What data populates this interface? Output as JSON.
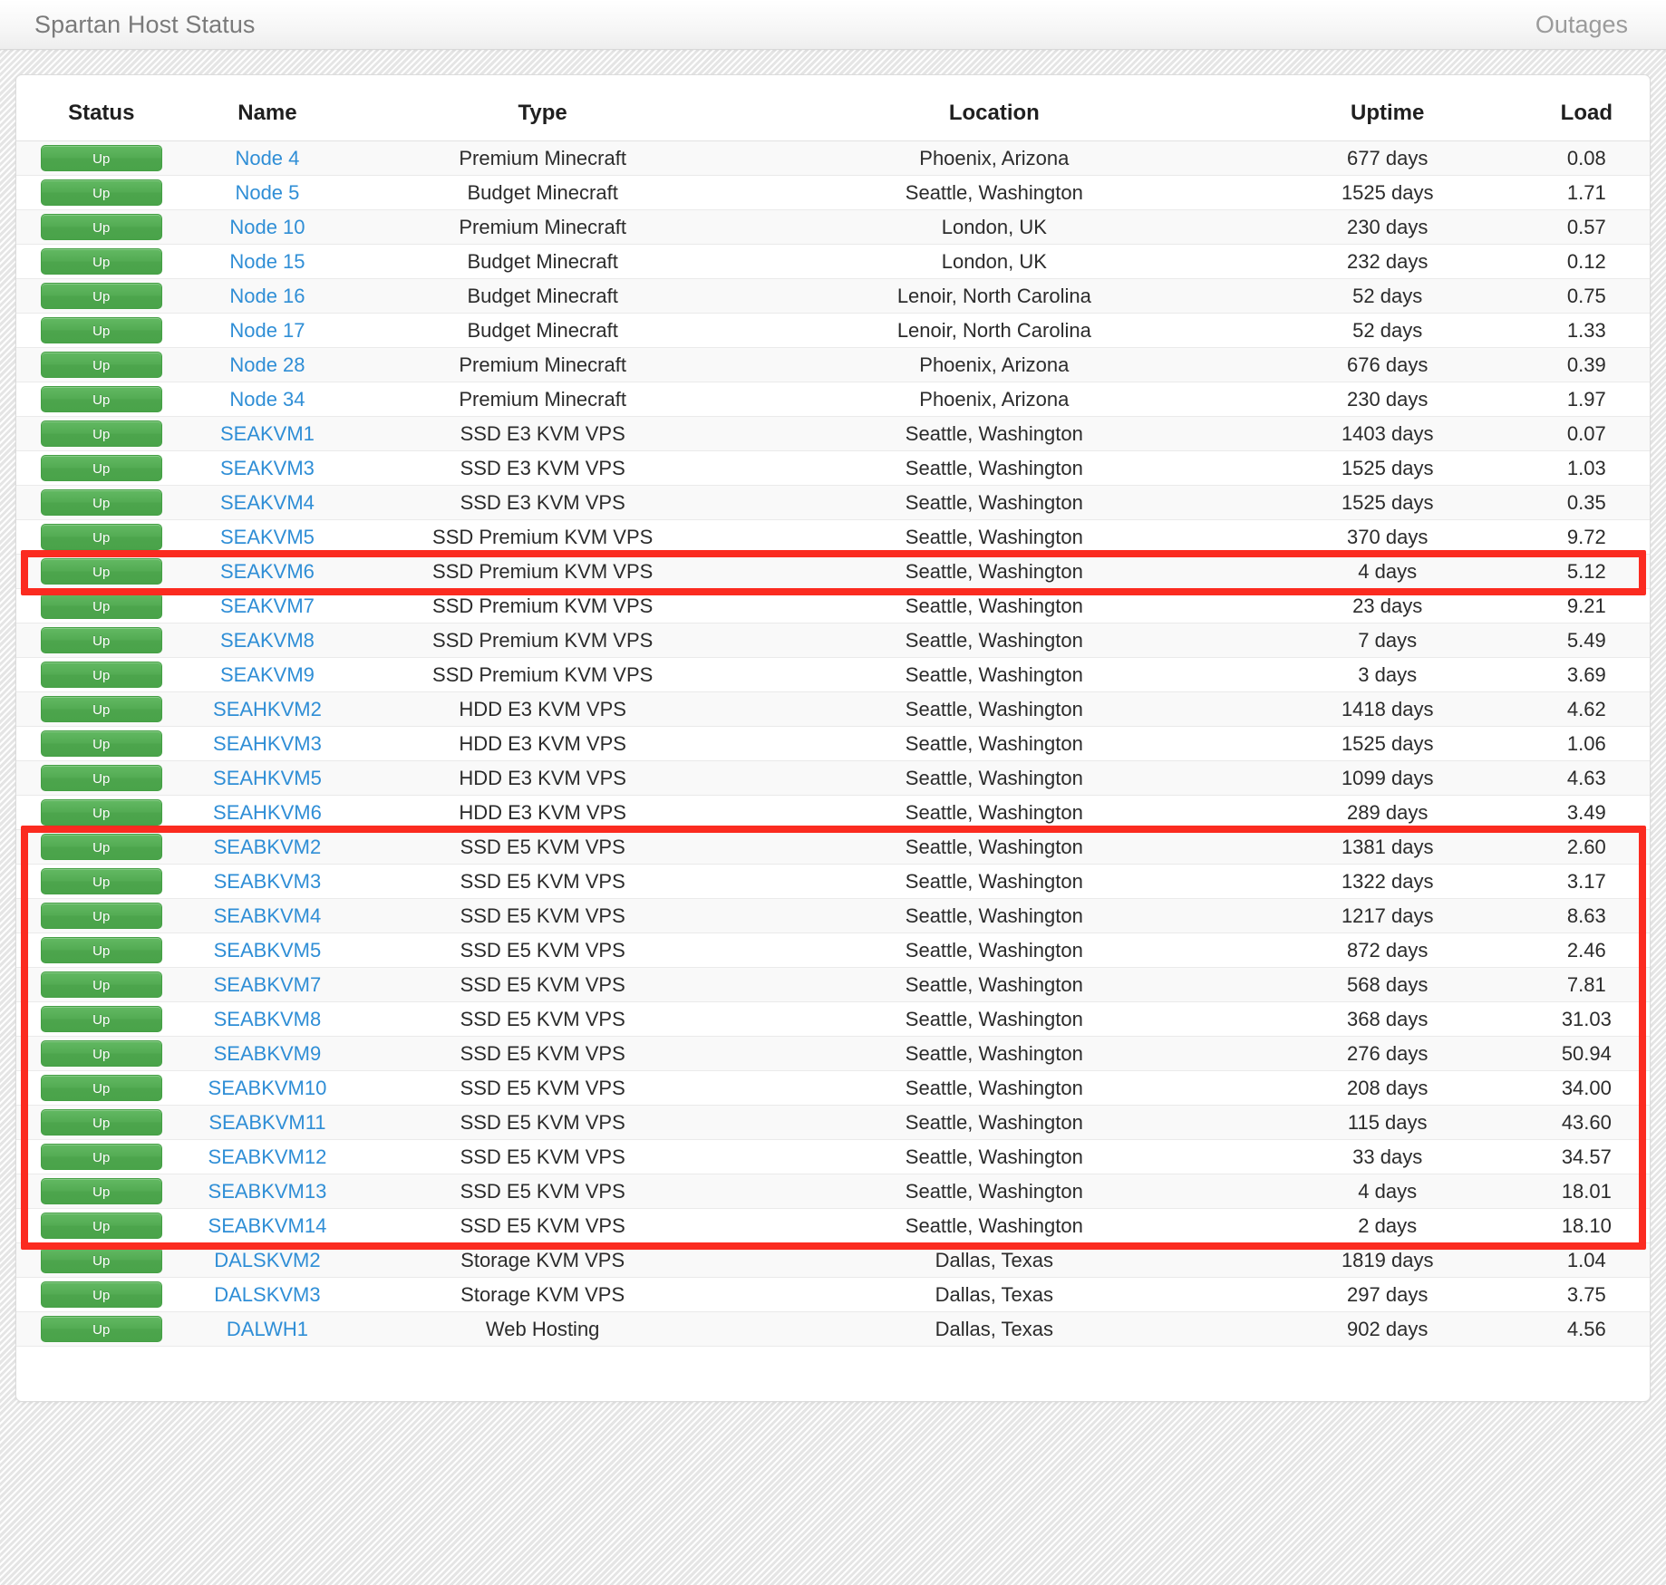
{
  "navbar": {
    "brand": "Spartan Host Status",
    "outages_link": "Outages"
  },
  "table": {
    "columns": [
      "Status",
      "Name",
      "Type",
      "Location",
      "Uptime",
      "Load"
    ],
    "rows": [
      {
        "status": "Up",
        "name": "Node 4",
        "type": "Premium Minecraft",
        "location": "Phoenix, Arizona",
        "uptime": "677 days",
        "load": "0.08"
      },
      {
        "status": "Up",
        "name": "Node 5",
        "type": "Budget Minecraft",
        "location": "Seattle, Washington",
        "uptime": "1525 days",
        "load": "1.71"
      },
      {
        "status": "Up",
        "name": "Node 10",
        "type": "Premium Minecraft",
        "location": "London, UK",
        "uptime": "230 days",
        "load": "0.57"
      },
      {
        "status": "Up",
        "name": "Node 15",
        "type": "Budget Minecraft",
        "location": "London, UK",
        "uptime": "232 days",
        "load": "0.12"
      },
      {
        "status": "Up",
        "name": "Node 16",
        "type": "Budget Minecraft",
        "location": "Lenoir, North Carolina",
        "uptime": "52 days",
        "load": "0.75"
      },
      {
        "status": "Up",
        "name": "Node 17",
        "type": "Budget Minecraft",
        "location": "Lenoir, North Carolina",
        "uptime": "52 days",
        "load": "1.33"
      },
      {
        "status": "Up",
        "name": "Node 28",
        "type": "Premium Minecraft",
        "location": "Phoenix, Arizona",
        "uptime": "676 days",
        "load": "0.39"
      },
      {
        "status": "Up",
        "name": "Node 34",
        "type": "Premium Minecraft",
        "location": "Phoenix, Arizona",
        "uptime": "230 days",
        "load": "1.97"
      },
      {
        "status": "Up",
        "name": "SEAKVM1",
        "type": "SSD E3 KVM VPS",
        "location": "Seattle, Washington",
        "uptime": "1403 days",
        "load": "0.07"
      },
      {
        "status": "Up",
        "name": "SEAKVM3",
        "type": "SSD E3 KVM VPS",
        "location": "Seattle, Washington",
        "uptime": "1525 days",
        "load": "1.03"
      },
      {
        "status": "Up",
        "name": "SEAKVM4",
        "type": "SSD E3 KVM VPS",
        "location": "Seattle, Washington",
        "uptime": "1525 days",
        "load": "0.35"
      },
      {
        "status": "Up",
        "name": "SEAKVM5",
        "type": "SSD Premium KVM VPS",
        "location": "Seattle, Washington",
        "uptime": "370 days",
        "load": "9.72"
      },
      {
        "status": "Up",
        "name": "SEAKVM6",
        "type": "SSD Premium KVM VPS",
        "location": "Seattle, Washington",
        "uptime": "4 days",
        "load": "5.12"
      },
      {
        "status": "Up",
        "name": "SEAKVM7",
        "type": "SSD Premium KVM VPS",
        "location": "Seattle, Washington",
        "uptime": "23 days",
        "load": "9.21"
      },
      {
        "status": "Up",
        "name": "SEAKVM8",
        "type": "SSD Premium KVM VPS",
        "location": "Seattle, Washington",
        "uptime": "7 days",
        "load": "5.49"
      },
      {
        "status": "Up",
        "name": "SEAKVM9",
        "type": "SSD Premium KVM VPS",
        "location": "Seattle, Washington",
        "uptime": "3 days",
        "load": "3.69"
      },
      {
        "status": "Up",
        "name": "SEAHKVM2",
        "type": "HDD E3 KVM VPS",
        "location": "Seattle, Washington",
        "uptime": "1418 days",
        "load": "4.62"
      },
      {
        "status": "Up",
        "name": "SEAHKVM3",
        "type": "HDD E3 KVM VPS",
        "location": "Seattle, Washington",
        "uptime": "1525 days",
        "load": "1.06"
      },
      {
        "status": "Up",
        "name": "SEAHKVM5",
        "type": "HDD E3 KVM VPS",
        "location": "Seattle, Washington",
        "uptime": "1099 days",
        "load": "4.63"
      },
      {
        "status": "Up",
        "name": "SEAHKVM6",
        "type": "HDD E3 KVM VPS",
        "location": "Seattle, Washington",
        "uptime": "289 days",
        "load": "3.49"
      },
      {
        "status": "Up",
        "name": "SEABKVM2",
        "type": "SSD E5 KVM VPS",
        "location": "Seattle, Washington",
        "uptime": "1381 days",
        "load": "2.60"
      },
      {
        "status": "Up",
        "name": "SEABKVM3",
        "type": "SSD E5 KVM VPS",
        "location": "Seattle, Washington",
        "uptime": "1322 days",
        "load": "3.17"
      },
      {
        "status": "Up",
        "name": "SEABKVM4",
        "type": "SSD E5 KVM VPS",
        "location": "Seattle, Washington",
        "uptime": "1217 days",
        "load": "8.63"
      },
      {
        "status": "Up",
        "name": "SEABKVM5",
        "type": "SSD E5 KVM VPS",
        "location": "Seattle, Washington",
        "uptime": "872 days",
        "load": "2.46"
      },
      {
        "status": "Up",
        "name": "SEABKVM7",
        "type": "SSD E5 KVM VPS",
        "location": "Seattle, Washington",
        "uptime": "568 days",
        "load": "7.81"
      },
      {
        "status": "Up",
        "name": "SEABKVM8",
        "type": "SSD E5 KVM VPS",
        "location": "Seattle, Washington",
        "uptime": "368 days",
        "load": "31.03"
      },
      {
        "status": "Up",
        "name": "SEABKVM9",
        "type": "SSD E5 KVM VPS",
        "location": "Seattle, Washington",
        "uptime": "276 days",
        "load": "50.94"
      },
      {
        "status": "Up",
        "name": "SEABKVM10",
        "type": "SSD E5 KVM VPS",
        "location": "Seattle, Washington",
        "uptime": "208 days",
        "load": "34.00"
      },
      {
        "status": "Up",
        "name": "SEABKVM11",
        "type": "SSD E5 KVM VPS",
        "location": "Seattle, Washington",
        "uptime": "115 days",
        "load": "43.60"
      },
      {
        "status": "Up",
        "name": "SEABKVM12",
        "type": "SSD E5 KVM VPS",
        "location": "Seattle, Washington",
        "uptime": "33 days",
        "load": "34.57"
      },
      {
        "status": "Up",
        "name": "SEABKVM13",
        "type": "SSD E5 KVM VPS",
        "location": "Seattle, Washington",
        "uptime": "4 days",
        "load": "18.01"
      },
      {
        "status": "Up",
        "name": "SEABKVM14",
        "type": "SSD E5 KVM VPS",
        "location": "Seattle, Washington",
        "uptime": "2 days",
        "load": "18.10"
      },
      {
        "status": "Up",
        "name": "DALSKVM2",
        "type": "Storage KVM VPS",
        "location": "Dallas, Texas",
        "uptime": "1819 days",
        "load": "1.04"
      },
      {
        "status": "Up",
        "name": "DALSKVM3",
        "type": "Storage KVM VPS",
        "location": "Dallas, Texas",
        "uptime": "297 days",
        "load": "3.75"
      },
      {
        "status": "Up",
        "name": "DALWH1",
        "type": "Web Hosting",
        "location": "Dallas, Texas",
        "uptime": "902 days",
        "load": "4.56"
      }
    ]
  },
  "annotations": {
    "highlight_color": "#fb2b20",
    "boxes": [
      {
        "label": "highlight-seakvm6-row",
        "row_start": 12,
        "row_end": 12
      },
      {
        "label": "highlight-seabkvm-rows",
        "row_start": 20,
        "row_end": 31
      }
    ]
  },
  "colors": {
    "status_badge_green": "#4ca54c",
    "link_blue": "#2f8ed6",
    "brand_gray": "#7a7a7a",
    "panel_white": "#ffffff"
  }
}
